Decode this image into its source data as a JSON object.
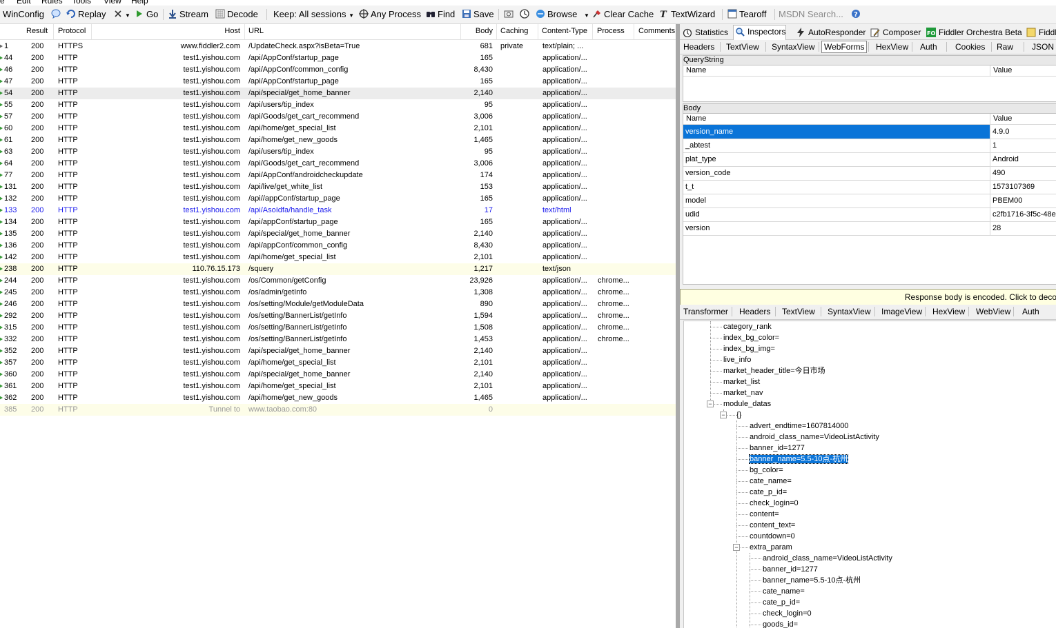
{
  "menu": [
    "e",
    "Edit",
    "Rules",
    "Tools",
    "View",
    "Help"
  ],
  "toolbar": {
    "winconfig": "WinConfig",
    "replay": "Replay",
    "go": "Go",
    "stream": "Stream",
    "decode": "Decode",
    "keep": "Keep: All sessions",
    "any_process": "Any Process",
    "find": "Find",
    "save": "Save",
    "browse": "Browse",
    "clear_cache": "Clear Cache",
    "textwizard": "TextWizard",
    "tearoff": "Tearoff",
    "search_placeholder": "MSDN Search..."
  },
  "sessions": {
    "headers": [
      "Result",
      "Protocol",
      "Host",
      "URL",
      "Body",
      "Caching",
      "Content-Type",
      "Process",
      "Comments"
    ],
    "rows": [
      {
        "num": "1",
        "result": "200",
        "protocol": "HTTPS",
        "host": "www.fiddler2.com",
        "url": "/UpdateCheck.aspx?isBeta=True",
        "body": "681",
        "caching": "private",
        "ctype": "text/plain; ...",
        "process": ""
      },
      {
        "num": "44",
        "result": "200",
        "protocol": "HTTP",
        "host": "test1.yishou.com",
        "url": "/api/AppConf/startup_page",
        "body": "165",
        "caching": "",
        "ctype": "application/...",
        "process": ""
      },
      {
        "num": "46",
        "result": "200",
        "protocol": "HTTP",
        "host": "test1.yishou.com",
        "url": "/api/AppConf/common_config",
        "body": "8,430",
        "caching": "",
        "ctype": "application/...",
        "process": ""
      },
      {
        "num": "47",
        "result": "200",
        "protocol": "HTTP",
        "host": "test1.yishou.com",
        "url": "/api/AppConf/startup_page",
        "body": "165",
        "caching": "",
        "ctype": "application/...",
        "process": ""
      },
      {
        "num": "54",
        "result": "200",
        "protocol": "HTTP",
        "host": "test1.yishou.com",
        "url": "/api/special/get_home_banner",
        "body": "2,140",
        "caching": "",
        "ctype": "application/...",
        "process": ""
      },
      {
        "num": "55",
        "result": "200",
        "protocol": "HTTP",
        "host": "test1.yishou.com",
        "url": "/api/users/tip_index",
        "body": "95",
        "caching": "",
        "ctype": "application/...",
        "process": ""
      },
      {
        "num": "57",
        "result": "200",
        "protocol": "HTTP",
        "host": "test1.yishou.com",
        "url": "/api/Goods/get_cart_recommend",
        "body": "3,006",
        "caching": "",
        "ctype": "application/...",
        "process": ""
      },
      {
        "num": "60",
        "result": "200",
        "protocol": "HTTP",
        "host": "test1.yishou.com",
        "url": "/api/home/get_special_list",
        "body": "2,101",
        "caching": "",
        "ctype": "application/...",
        "process": ""
      },
      {
        "num": "61",
        "result": "200",
        "protocol": "HTTP",
        "host": "test1.yishou.com",
        "url": "/api/home/get_new_goods",
        "body": "1,465",
        "caching": "",
        "ctype": "application/...",
        "process": ""
      },
      {
        "num": "63",
        "result": "200",
        "protocol": "HTTP",
        "host": "test1.yishou.com",
        "url": "/api/users/tip_index",
        "body": "95",
        "caching": "",
        "ctype": "application/...",
        "process": ""
      },
      {
        "num": "64",
        "result": "200",
        "protocol": "HTTP",
        "host": "test1.yishou.com",
        "url": "/api/Goods/get_cart_recommend",
        "body": "3,006",
        "caching": "",
        "ctype": "application/...",
        "process": ""
      },
      {
        "num": "77",
        "result": "200",
        "protocol": "HTTP",
        "host": "test1.yishou.com",
        "url": "/api/AppConf/androidcheckupdate",
        "body": "174",
        "caching": "",
        "ctype": "application/...",
        "process": ""
      },
      {
        "num": "131",
        "result": "200",
        "protocol": "HTTP",
        "host": "test1.yishou.com",
        "url": "/api/live/get_white_list",
        "body": "153",
        "caching": "",
        "ctype": "application/...",
        "process": ""
      },
      {
        "num": "132",
        "result": "200",
        "protocol": "HTTP",
        "host": "test1.yishou.com",
        "url": "/api//appConf/startup_page",
        "body": "165",
        "caching": "",
        "ctype": "application/...",
        "process": ""
      },
      {
        "num": "133",
        "result": "200",
        "protocol": "HTTP",
        "host": "test1.yishou.com",
        "url": "/api/AsoIdfa/handle_task",
        "body": "17",
        "caching": "",
        "ctype": "text/html",
        "process": ""
      },
      {
        "num": "134",
        "result": "200",
        "protocol": "HTTP",
        "host": "test1.yishou.com",
        "url": "/api/appConf/startup_page",
        "body": "165",
        "caching": "",
        "ctype": "application/...",
        "process": ""
      },
      {
        "num": "135",
        "result": "200",
        "protocol": "HTTP",
        "host": "test1.yishou.com",
        "url": "/api/special/get_home_banner",
        "body": "2,140",
        "caching": "",
        "ctype": "application/...",
        "process": ""
      },
      {
        "num": "136",
        "result": "200",
        "protocol": "HTTP",
        "host": "test1.yishou.com",
        "url": "/api/appConf/common_config",
        "body": "8,430",
        "caching": "",
        "ctype": "application/...",
        "process": ""
      },
      {
        "num": "142",
        "result": "200",
        "protocol": "HTTP",
        "host": "test1.yishou.com",
        "url": "/api/home/get_special_list",
        "body": "2,101",
        "caching": "",
        "ctype": "application/...",
        "process": ""
      },
      {
        "num": "238",
        "result": "200",
        "protocol": "HTTP",
        "host": "110.76.15.173",
        "url": "/squery",
        "body": "1,217",
        "caching": "",
        "ctype": "text/json",
        "process": ""
      },
      {
        "num": "244",
        "result": "200",
        "protocol": "HTTP",
        "host": "test1.yishou.com",
        "url": "/os/Common/getConfig",
        "body": "23,926",
        "caching": "",
        "ctype": "application/...",
        "process": "chrome..."
      },
      {
        "num": "245",
        "result": "200",
        "protocol": "HTTP",
        "host": "test1.yishou.com",
        "url": "/os/admin/getInfo",
        "body": "1,308",
        "caching": "",
        "ctype": "application/...",
        "process": "chrome..."
      },
      {
        "num": "246",
        "result": "200",
        "protocol": "HTTP",
        "host": "test1.yishou.com",
        "url": "/os/setting/Module/getModuleData",
        "body": "890",
        "caching": "",
        "ctype": "application/...",
        "process": "chrome..."
      },
      {
        "num": "292",
        "result": "200",
        "protocol": "HTTP",
        "host": "test1.yishou.com",
        "url": "/os/setting/BannerList/getInfo",
        "body": "1,594",
        "caching": "",
        "ctype": "application/...",
        "process": "chrome..."
      },
      {
        "num": "315",
        "result": "200",
        "protocol": "HTTP",
        "host": "test1.yishou.com",
        "url": "/os/setting/BannerList/getInfo",
        "body": "1,508",
        "caching": "",
        "ctype": "application/...",
        "process": "chrome..."
      },
      {
        "num": "332",
        "result": "200",
        "protocol": "HTTP",
        "host": "test1.yishou.com",
        "url": "/os/setting/BannerList/getInfo",
        "body": "1,453",
        "caching": "",
        "ctype": "application/...",
        "process": "chrome..."
      },
      {
        "num": "352",
        "result": "200",
        "protocol": "HTTP",
        "host": "test1.yishou.com",
        "url": "/api/special/get_home_banner",
        "body": "2,140",
        "caching": "",
        "ctype": "application/...",
        "process": ""
      },
      {
        "num": "357",
        "result": "200",
        "protocol": "HTTP",
        "host": "test1.yishou.com",
        "url": "/api/home/get_special_list",
        "body": "2,101",
        "caching": "",
        "ctype": "application/...",
        "process": ""
      },
      {
        "num": "360",
        "result": "200",
        "protocol": "HTTP",
        "host": "test1.yishou.com",
        "url": "/api/special/get_home_banner",
        "body": "2,140",
        "caching": "",
        "ctype": "application/...",
        "process": ""
      },
      {
        "num": "361",
        "result": "200",
        "protocol": "HTTP",
        "host": "test1.yishou.com",
        "url": "/api/home/get_special_list",
        "body": "2,101",
        "caching": "",
        "ctype": "application/...",
        "process": ""
      },
      {
        "num": "362",
        "result": "200",
        "protocol": "HTTP",
        "host": "test1.yishou.com",
        "url": "/api/home/get_new_goods",
        "body": "1,465",
        "caching": "",
        "ctype": "application/...",
        "process": ""
      },
      {
        "num": "385",
        "result": "200",
        "protocol": "HTTP",
        "host": "Tunnel to",
        "url": "www.taobao.com:80",
        "body": "0",
        "caching": "",
        "ctype": "",
        "process": ""
      }
    ]
  },
  "inspector_tabs": [
    "Statistics",
    "Inspectors",
    "AutoResponder",
    "Composer",
    "Fiddler Orchestra Beta",
    "Fiddle"
  ],
  "request_tabs": [
    "Headers",
    "TextView",
    "SyntaxView",
    "WebForms",
    "HexView",
    "Auth",
    "Cookies",
    "Raw",
    "JSON"
  ],
  "querystring": {
    "title": "QueryString",
    "col_name": "Name",
    "col_value": "Value"
  },
  "body": {
    "title": "Body",
    "col_name": "Name",
    "col_value": "Value",
    "rows": [
      {
        "name": "version_name",
        "value": "4.9.0"
      },
      {
        "name": "_abtest",
        "value": "1"
      },
      {
        "name": "plat_type",
        "value": "Android"
      },
      {
        "name": "version_code",
        "value": "490"
      },
      {
        "name": "t_t",
        "value": "1573107369"
      },
      {
        "name": "model",
        "value": "PBEM00"
      },
      {
        "name": "udid",
        "value": "c2fb1716-3f5c-48e"
      },
      {
        "name": "version",
        "value": "28"
      }
    ]
  },
  "notice": "Response body is encoded. Click to deco",
  "response_tabs": [
    "Transformer",
    "Headers",
    "TextView",
    "SyntaxView",
    "ImageView",
    "HexView",
    "WebView",
    "Auth"
  ],
  "tree": [
    "category_rank",
    "index_bg_color=",
    "index_bg_img=",
    "live_info",
    "market_header_title=今日市场",
    "market_list",
    "market_nav",
    "module_datas",
    "{}",
    "advert_endtime=1607814000",
    "android_class_name=VideoListActivity",
    "banner_id=1277",
    "banner_name=5.5-10点-杭州",
    "bg_color=",
    "cate_name=",
    "cate_p_id=",
    "check_login=0",
    "content=",
    "content_text=",
    "countdown=0",
    "extra_param",
    "android_class_name=VideoListActivity",
    "banner_id=1277",
    "banner_name=5.5-10点-杭州",
    "cate_name=",
    "cate_p_id=",
    "check_login=0",
    "goods_id="
  ]
}
